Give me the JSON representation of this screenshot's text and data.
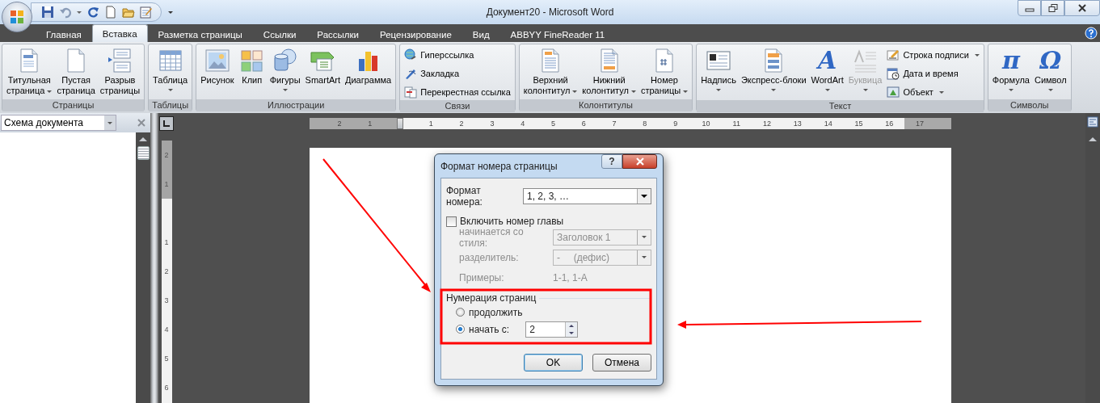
{
  "window": {
    "title": "Документ20 - Microsoft Word"
  },
  "tabs": [
    {
      "label": "Главная",
      "selected": false
    },
    {
      "label": "Вставка",
      "selected": true
    },
    {
      "label": "Разметка страницы",
      "selected": false
    },
    {
      "label": "Ссылки",
      "selected": false
    },
    {
      "label": "Рассылки",
      "selected": false
    },
    {
      "label": "Рецензирование",
      "selected": false
    },
    {
      "label": "Вид",
      "selected": false
    },
    {
      "label": "ABBYY FineReader 11",
      "selected": false
    }
  ],
  "ribbon": [
    {
      "label": "Страницы",
      "items": [
        {
          "label": "Титульная\nстраница",
          "kind": "large",
          "dropdown": true,
          "disabled": false
        },
        {
          "label": "Пустая\nстраница",
          "kind": "large",
          "dropdown": false,
          "disabled": false
        },
        {
          "label": "Разрыв\nстраницы",
          "kind": "large",
          "dropdown": false,
          "disabled": false
        }
      ]
    },
    {
      "label": "Таблицы",
      "items": [
        {
          "label": "Таблица",
          "kind": "large",
          "dropdown": true,
          "disabled": false
        }
      ]
    },
    {
      "label": "Иллюстрации",
      "items": [
        {
          "label": "Рисунок",
          "kind": "large",
          "dropdown": false,
          "disabled": false
        },
        {
          "label": "Клип",
          "kind": "large",
          "dropdown": false,
          "disabled": false
        },
        {
          "label": "Фигуры",
          "kind": "large",
          "dropdown": true,
          "disabled": false
        },
        {
          "label": "SmartArt",
          "kind": "large",
          "dropdown": false,
          "disabled": false
        },
        {
          "label": "Диаграмма",
          "kind": "large",
          "dropdown": false,
          "disabled": false
        }
      ]
    },
    {
      "label": "Связи",
      "items": [
        {
          "label": "Гиперссылка",
          "kind": "small",
          "dropdown": false,
          "disabled": false
        },
        {
          "label": "Закладка",
          "kind": "small",
          "dropdown": false,
          "disabled": false
        },
        {
          "label": "Перекрестная ссылка",
          "kind": "small",
          "dropdown": false,
          "disabled": false
        }
      ]
    },
    {
      "label": "Колонтитулы",
      "items": [
        {
          "label": "Верхний\nколонтитул",
          "kind": "large",
          "dropdown": true,
          "disabled": false
        },
        {
          "label": "Нижний\nколонтитул",
          "kind": "large",
          "dropdown": true,
          "disabled": false
        },
        {
          "label": "Номер\nстраницы",
          "kind": "large",
          "dropdown": true,
          "disabled": false
        }
      ]
    },
    {
      "label": "Текст",
      "items": [
        {
          "label": "Надпись",
          "kind": "large",
          "dropdown": true,
          "disabled": false
        },
        {
          "label": "Экспресс-блоки",
          "kind": "large",
          "dropdown": true,
          "disabled": false
        },
        {
          "label": "WordArt",
          "kind": "large",
          "dropdown": true,
          "disabled": false,
          "glyph": "A"
        },
        {
          "label": "Буквица",
          "kind": "large",
          "dropdown": true,
          "disabled": true
        },
        {
          "label": "Строка подписи",
          "kind": "small",
          "dropdown": true,
          "disabled": false
        },
        {
          "label": "Дата и время",
          "kind": "small",
          "dropdown": false,
          "disabled": false
        },
        {
          "label": "Объект",
          "kind": "small",
          "dropdown": true,
          "disabled": false
        }
      ]
    },
    {
      "label": "Символы",
      "items": [
        {
          "label": "Формула",
          "kind": "large",
          "dropdown": true,
          "disabled": false,
          "glyph": "π"
        },
        {
          "label": "Символ",
          "kind": "large",
          "dropdown": true,
          "disabled": false,
          "glyph": "Ω"
        }
      ]
    }
  ],
  "navigation_pane": {
    "title": "Схема документа"
  },
  "horizontal_ruler": [
    {
      "label": "2",
      "margin": true
    },
    {
      "label": "1",
      "margin": true
    },
    {
      "label": "1",
      "margin": false
    },
    {
      "label": "2",
      "margin": false
    },
    {
      "label": "3",
      "margin": false
    },
    {
      "label": "4",
      "margin": false
    },
    {
      "label": "5",
      "margin": false
    },
    {
      "label": "6",
      "margin": false
    },
    {
      "label": "7",
      "margin": false
    },
    {
      "label": "8",
      "margin": false
    },
    {
      "label": "9",
      "margin": false
    },
    {
      "label": "10",
      "margin": false
    },
    {
      "label": "11",
      "margin": false
    },
    {
      "label": "12",
      "margin": false
    },
    {
      "label": "13",
      "margin": false
    },
    {
      "label": "14",
      "margin": false
    },
    {
      "label": "15",
      "margin": false
    },
    {
      "label": "16",
      "margin": false
    },
    {
      "label": "17",
      "margin": true
    }
  ],
  "vertical_ruler": [
    {
      "label": "2",
      "margin": true
    },
    {
      "label": "1",
      "margin": true
    },
    {
      "label": "1",
      "margin": false
    },
    {
      "label": "2",
      "margin": false
    },
    {
      "label": "3",
      "margin": false
    },
    {
      "label": "4",
      "margin": false
    },
    {
      "label": "5",
      "margin": false
    },
    {
      "label": "6",
      "margin": false
    }
  ],
  "dialog": {
    "title": "Формат номера страницы",
    "help_button": "?",
    "number_format": {
      "label": "Формат номера:",
      "value": "1, 2, 3, …"
    },
    "include_chapter": {
      "label": "Включить номер главы",
      "checked": false
    },
    "chapter_rows": [
      {
        "label": "начинается со стиля:",
        "value": "Заголовок 1",
        "kind": "select",
        "disabled": true
      },
      {
        "label": "разделитель:",
        "value": "-     (дефис)",
        "kind": "select",
        "disabled": true
      },
      {
        "label": "Примеры:",
        "value": "1-1, 1-A",
        "kind": "text",
        "disabled": true
      }
    ],
    "page_numbering": {
      "title": "Нумерация страниц",
      "options": [
        {
          "label": "продолжить",
          "selected": false
        },
        {
          "label": "начать с:",
          "selected": true
        }
      ],
      "start_at": "2"
    },
    "buttons": [
      "OK",
      "Отмена"
    ]
  }
}
